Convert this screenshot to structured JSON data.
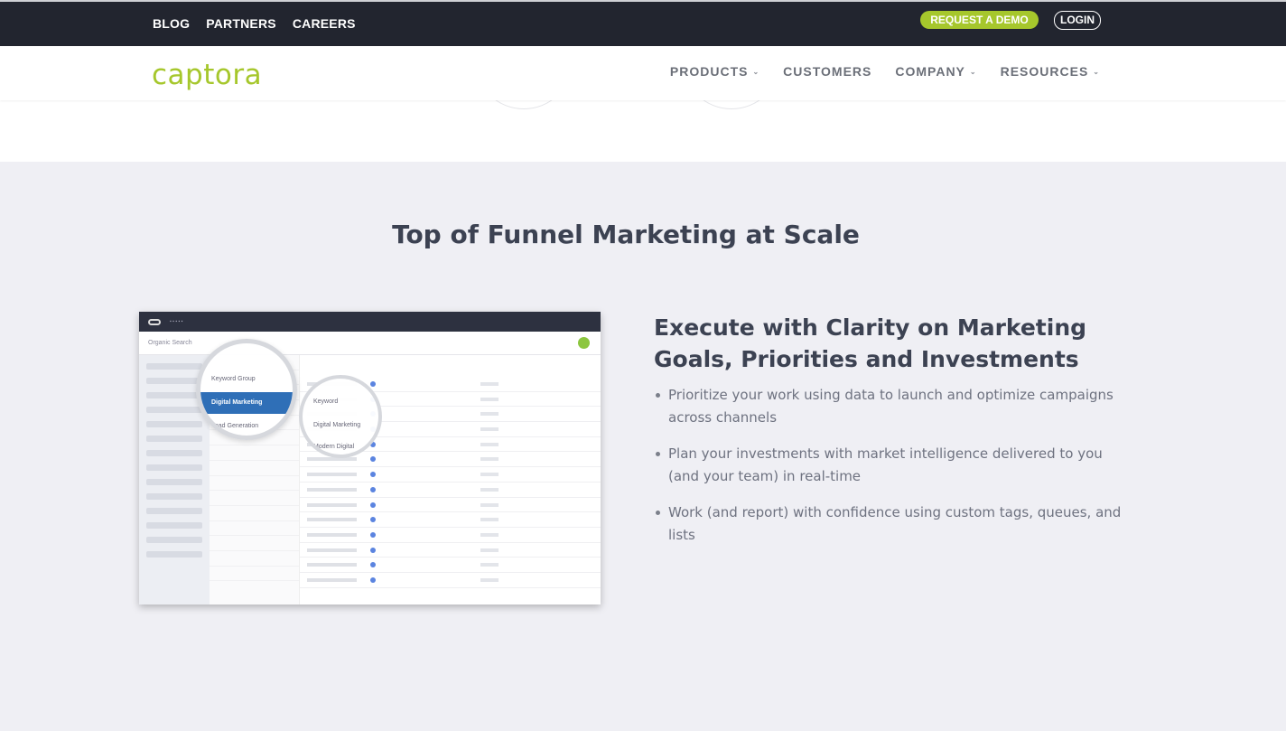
{
  "topbar": {
    "links": [
      "BLOG",
      "PARTNERS",
      "CAREERS"
    ],
    "request_demo": "REQUEST A DEMO",
    "login": "LOGIN"
  },
  "brand": {
    "logo_text": "captora",
    "accent_color": "#a6c72c"
  },
  "nav": {
    "items": [
      {
        "label": "PRODUCTS",
        "dropdown": true
      },
      {
        "label": "CUSTOMERS",
        "dropdown": false
      },
      {
        "label": "COMPANY",
        "dropdown": true
      },
      {
        "label": "RESOURCES",
        "dropdown": true
      }
    ]
  },
  "section": {
    "title": "Top of Funnel Marketing at Scale",
    "screenshot": {
      "search_label": "Organic Search",
      "group_header": "Keyword Group",
      "active_group": "Digital Marketing",
      "group_2": "Lead Generation",
      "keyword_header": "Keyword",
      "keyword_1": "Digital Marketing",
      "keyword_2": "Modern Digital"
    },
    "feature_title": "Execute with Clarity on Marketing Goals, Priorities and Investments",
    "bullets": [
      "Prioritize your work using data to launch and optimize campaigns across channels",
      "Plan your investments with market intelligence delivered to you (and your team) in real-time",
      "Work (and report) with confidence using custom tags, queues, and lists"
    ]
  }
}
